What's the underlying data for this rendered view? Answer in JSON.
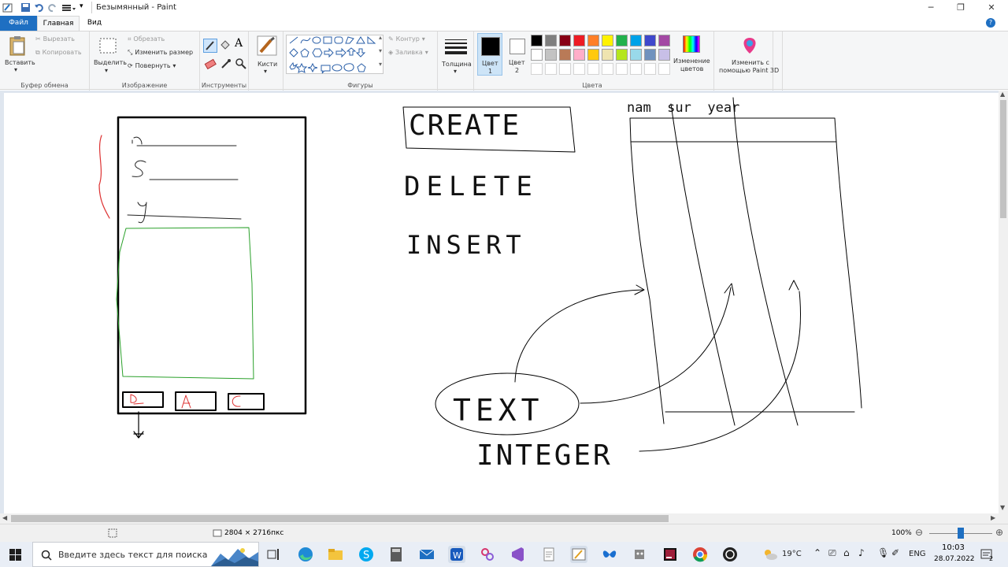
{
  "window": {
    "title": "Безымянный - Paint",
    "minimize": "─",
    "restore": "❐",
    "close": "✕"
  },
  "tabs": {
    "file": "Файл",
    "home": "Главная",
    "view": "Вид",
    "help": "?"
  },
  "clipboard": {
    "paste": "Вставить",
    "cut": "Вырезать",
    "copy": "Копировать",
    "group": "Буфер обмена"
  },
  "image": {
    "select": "Выделить",
    "crop": "Обрезать",
    "resize": "Изменить размер",
    "rotate": "Повернуть",
    "group": "Изображение"
  },
  "tools": {
    "group": "Инструменты"
  },
  "brushes": {
    "label": "Кисти"
  },
  "shapes": {
    "outline": "Контур",
    "fill": "Заливка",
    "group": "Фигуры"
  },
  "size": {
    "label": "Толщина"
  },
  "color1": {
    "label": "Цвет",
    "num": "1"
  },
  "color2": {
    "label": "Цвет",
    "num": "2"
  },
  "colors": {
    "group": "Цвета",
    "edit1": "Изменение",
    "edit2": "цветов",
    "palette_row1": [
      "#000000",
      "#7f7f7f",
      "#880015",
      "#ed1c24",
      "#ff7f27",
      "#fff200",
      "#22b14c",
      "#00a2e8",
      "#3f48cc",
      "#a349a4"
    ],
    "palette_row2": [
      "#ffffff",
      "#c3c3c3",
      "#b97a57",
      "#ffaec9",
      "#ffc90e",
      "#efe4b0",
      "#b5e61d",
      "#99d9ea",
      "#7092be",
      "#c8bfe7"
    ]
  },
  "paint3d": {
    "line1": "Изменить с",
    "line2": "помощью Paint 3D"
  },
  "canvas_text": {
    "create": "CREATE",
    "delete": "DELETE",
    "insert": "INSERT",
    "text": "TEXT",
    "integer": "INTEGER",
    "btn_d": "D",
    "btn_a": "A",
    "btn_c": "C",
    "field_n": "n",
    "field_s": "S",
    "field_y": "y",
    "col_heads": "nam  sur  year"
  },
  "status": {
    "dimensions": "2804 × 2716пкс",
    "zoom": "100%"
  },
  "taskbar": {
    "search_placeholder": "Введите здесь текст для поиска",
    "weather": "19°C",
    "lang": "ENG",
    "time": "10:03",
    "date": "28.07.2022",
    "notif": "2"
  }
}
